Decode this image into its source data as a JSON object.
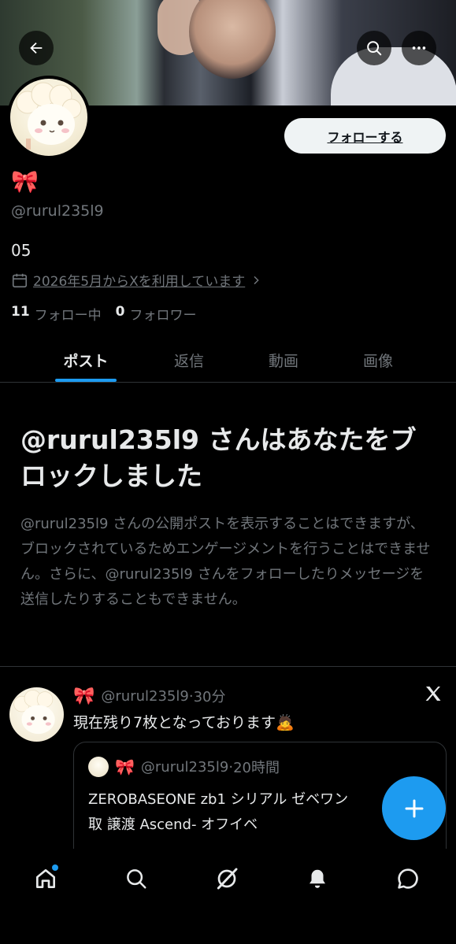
{
  "profile": {
    "display_name_emoji": "🎀",
    "handle": "@rurul235l9",
    "bio": "05",
    "joined": "2026年5月からXを利用しています",
    "following_count": "11",
    "following_label": "フォロー中",
    "followers_count": "0",
    "followers_label": "フォロワー",
    "follow_button": "フォローする"
  },
  "tabs": [
    {
      "label": "ポスト"
    },
    {
      "label": "返信"
    },
    {
      "label": "動画"
    },
    {
      "label": "画像"
    }
  ],
  "blocked": {
    "title": "@rurul235l9 さんはあなたをブロックしました",
    "body": "@rurul235l9 さんの公開ポストを表示することはできますが、ブロックされているためエンゲージメントを行うことはできません。さらに、@rurul235l9 さんをフォローしたりメッセージを送信したりすることもできません。"
  },
  "post": {
    "author_emoji": "🎀",
    "handle": "@rurul235l9",
    "time": "30分",
    "text": "現在残り7枚となっております🙇",
    "quote": {
      "author_emoji": "🎀",
      "handle": "@rurul235l9",
      "time": "20時間",
      "text_line1": "ZEROBASEONE zb1 シリアル ゼベワン",
      "text_line2": "取 譲渡 Ascend- オフイベ"
    }
  },
  "colors": {
    "accent": "#1d9bf0",
    "background": "#000000",
    "text_primary": "#e7e9ea",
    "text_secondary": "#71767b",
    "border": "#2f3336"
  }
}
